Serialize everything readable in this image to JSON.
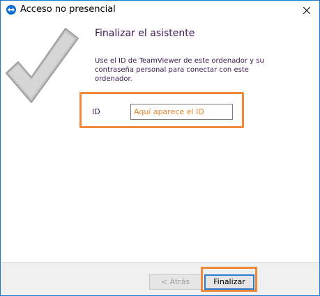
{
  "window": {
    "title": "Acceso no presencial",
    "app_icon": "teamviewer-icon",
    "close_icon": "close-icon"
  },
  "wizard": {
    "title": "Finalizar el asistente",
    "description": "Use el ID de TeamViewer de este ordenador y su contraseña personal para conectar con este ordenador.",
    "graphic": "checkmark-icon"
  },
  "id_row": {
    "label": "ID",
    "value": "Aquí aparece el ID"
  },
  "footer": {
    "back_label": "< Atrás",
    "finish_label": "Finalizar"
  },
  "colors": {
    "highlight": "#f0893a",
    "title_text": "#3d1750",
    "id_text": "#e8852b",
    "focus_border": "#2a7bd4"
  }
}
